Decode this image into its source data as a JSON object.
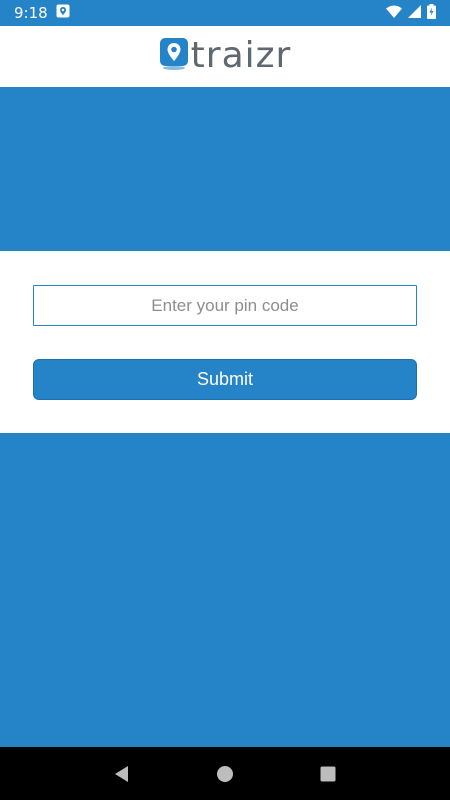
{
  "status_bar": {
    "time": "9:18",
    "icons": [
      "location-notification-icon",
      "wifi-icon",
      "signal-icon",
      "battery-charging-icon"
    ]
  },
  "header": {
    "brand_name": "traizr",
    "logo_icon": "map-pin-icon"
  },
  "form": {
    "pin_input_placeholder": "Enter your pin code",
    "pin_input_value": "",
    "submit_label": "Submit"
  },
  "nav_bar": {
    "icons": [
      "back-icon",
      "home-icon",
      "recents-icon"
    ]
  },
  "colors": {
    "primary": "#2583c8",
    "white": "#ffffff",
    "nav": "#000000",
    "brand_text": "#5e6870"
  }
}
